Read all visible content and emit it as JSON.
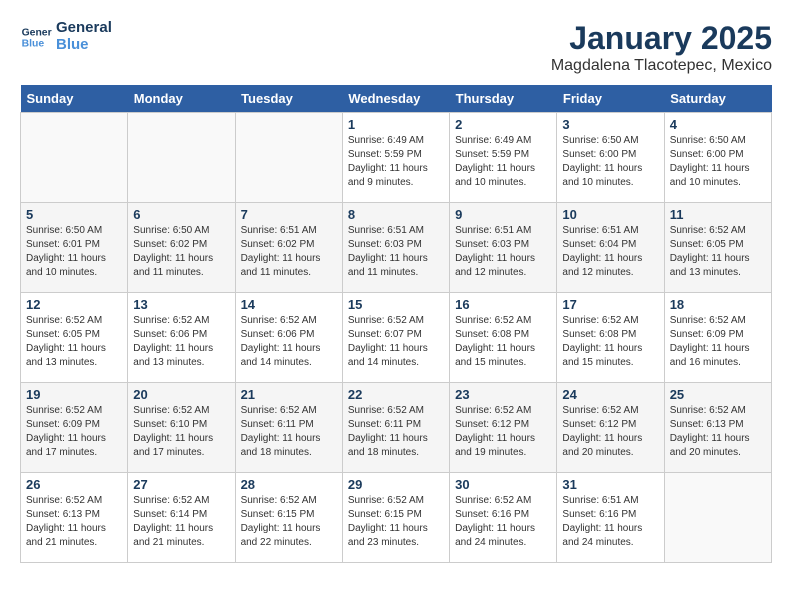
{
  "header": {
    "logo_line1": "General",
    "logo_line2": "Blue",
    "month_title": "January 2025",
    "location": "Magdalena Tlacotepec, Mexico"
  },
  "weekdays": [
    "Sunday",
    "Monday",
    "Tuesday",
    "Wednesday",
    "Thursday",
    "Friday",
    "Saturday"
  ],
  "weeks": [
    [
      {
        "day": "",
        "info": ""
      },
      {
        "day": "",
        "info": ""
      },
      {
        "day": "",
        "info": ""
      },
      {
        "day": "1",
        "info": "Sunrise: 6:49 AM\nSunset: 5:59 PM\nDaylight: 11 hours\nand 9 minutes."
      },
      {
        "day": "2",
        "info": "Sunrise: 6:49 AM\nSunset: 5:59 PM\nDaylight: 11 hours\nand 10 minutes."
      },
      {
        "day": "3",
        "info": "Sunrise: 6:50 AM\nSunset: 6:00 PM\nDaylight: 11 hours\nand 10 minutes."
      },
      {
        "day": "4",
        "info": "Sunrise: 6:50 AM\nSunset: 6:00 PM\nDaylight: 11 hours\nand 10 minutes."
      }
    ],
    [
      {
        "day": "5",
        "info": "Sunrise: 6:50 AM\nSunset: 6:01 PM\nDaylight: 11 hours\nand 10 minutes."
      },
      {
        "day": "6",
        "info": "Sunrise: 6:50 AM\nSunset: 6:02 PM\nDaylight: 11 hours\nand 11 minutes."
      },
      {
        "day": "7",
        "info": "Sunrise: 6:51 AM\nSunset: 6:02 PM\nDaylight: 11 hours\nand 11 minutes."
      },
      {
        "day": "8",
        "info": "Sunrise: 6:51 AM\nSunset: 6:03 PM\nDaylight: 11 hours\nand 11 minutes."
      },
      {
        "day": "9",
        "info": "Sunrise: 6:51 AM\nSunset: 6:03 PM\nDaylight: 11 hours\nand 12 minutes."
      },
      {
        "day": "10",
        "info": "Sunrise: 6:51 AM\nSunset: 6:04 PM\nDaylight: 11 hours\nand 12 minutes."
      },
      {
        "day": "11",
        "info": "Sunrise: 6:52 AM\nSunset: 6:05 PM\nDaylight: 11 hours\nand 13 minutes."
      }
    ],
    [
      {
        "day": "12",
        "info": "Sunrise: 6:52 AM\nSunset: 6:05 PM\nDaylight: 11 hours\nand 13 minutes."
      },
      {
        "day": "13",
        "info": "Sunrise: 6:52 AM\nSunset: 6:06 PM\nDaylight: 11 hours\nand 13 minutes."
      },
      {
        "day": "14",
        "info": "Sunrise: 6:52 AM\nSunset: 6:06 PM\nDaylight: 11 hours\nand 14 minutes."
      },
      {
        "day": "15",
        "info": "Sunrise: 6:52 AM\nSunset: 6:07 PM\nDaylight: 11 hours\nand 14 minutes."
      },
      {
        "day": "16",
        "info": "Sunrise: 6:52 AM\nSunset: 6:08 PM\nDaylight: 11 hours\nand 15 minutes."
      },
      {
        "day": "17",
        "info": "Sunrise: 6:52 AM\nSunset: 6:08 PM\nDaylight: 11 hours\nand 15 minutes."
      },
      {
        "day": "18",
        "info": "Sunrise: 6:52 AM\nSunset: 6:09 PM\nDaylight: 11 hours\nand 16 minutes."
      }
    ],
    [
      {
        "day": "19",
        "info": "Sunrise: 6:52 AM\nSunset: 6:09 PM\nDaylight: 11 hours\nand 17 minutes."
      },
      {
        "day": "20",
        "info": "Sunrise: 6:52 AM\nSunset: 6:10 PM\nDaylight: 11 hours\nand 17 minutes."
      },
      {
        "day": "21",
        "info": "Sunrise: 6:52 AM\nSunset: 6:11 PM\nDaylight: 11 hours\nand 18 minutes."
      },
      {
        "day": "22",
        "info": "Sunrise: 6:52 AM\nSunset: 6:11 PM\nDaylight: 11 hours\nand 18 minutes."
      },
      {
        "day": "23",
        "info": "Sunrise: 6:52 AM\nSunset: 6:12 PM\nDaylight: 11 hours\nand 19 minutes."
      },
      {
        "day": "24",
        "info": "Sunrise: 6:52 AM\nSunset: 6:12 PM\nDaylight: 11 hours\nand 20 minutes."
      },
      {
        "day": "25",
        "info": "Sunrise: 6:52 AM\nSunset: 6:13 PM\nDaylight: 11 hours\nand 20 minutes."
      }
    ],
    [
      {
        "day": "26",
        "info": "Sunrise: 6:52 AM\nSunset: 6:13 PM\nDaylight: 11 hours\nand 21 minutes."
      },
      {
        "day": "27",
        "info": "Sunrise: 6:52 AM\nSunset: 6:14 PM\nDaylight: 11 hours\nand 21 minutes."
      },
      {
        "day": "28",
        "info": "Sunrise: 6:52 AM\nSunset: 6:15 PM\nDaylight: 11 hours\nand 22 minutes."
      },
      {
        "day": "29",
        "info": "Sunrise: 6:52 AM\nSunset: 6:15 PM\nDaylight: 11 hours\nand 23 minutes."
      },
      {
        "day": "30",
        "info": "Sunrise: 6:52 AM\nSunset: 6:16 PM\nDaylight: 11 hours\nand 24 minutes."
      },
      {
        "day": "31",
        "info": "Sunrise: 6:51 AM\nSunset: 6:16 PM\nDaylight: 11 hours\nand 24 minutes."
      },
      {
        "day": "",
        "info": ""
      }
    ]
  ]
}
